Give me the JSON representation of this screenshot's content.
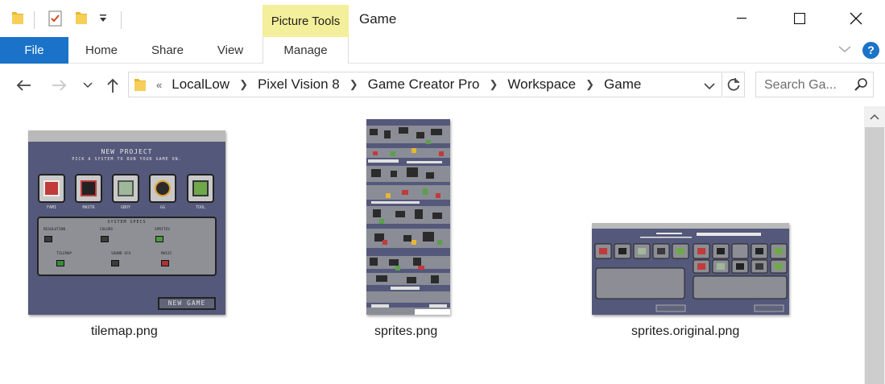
{
  "window": {
    "title": "Game",
    "context_tab_group": "Picture Tools"
  },
  "ribbon": {
    "tabs": [
      "File",
      "Home",
      "Share",
      "View",
      "Manage"
    ],
    "help": "?"
  },
  "address": {
    "path": [
      "LocalLow",
      "Pixel Vision 8",
      "Game Creator Pro",
      "Workspace",
      "Game"
    ],
    "overflow": "«",
    "search_placeholder": "Search Ga..."
  },
  "files": [
    {
      "name": "tilemap.png"
    },
    {
      "name": "sprites.png"
    },
    {
      "name": "sprites.original.png"
    }
  ],
  "thumbnail_text": {
    "title": "NEW PROJECT",
    "subtitle": "PICK A SYSTEM TO RUN YOUR GAME ON.",
    "systems": [
      "FAMI",
      "MASTR",
      "GBOY",
      "GG",
      "TOOL"
    ],
    "specs_title": "SYSTEM SPECS",
    "spec_labels": [
      "RESOLUTION",
      "COLORS",
      "SPRITES",
      "TILEMAP",
      "SOUND SFX",
      "MUSIC"
    ],
    "button": "NEW GAME"
  },
  "colors": {
    "accent": "#1a73c8",
    "picture_tools": "#f4ef9a"
  }
}
